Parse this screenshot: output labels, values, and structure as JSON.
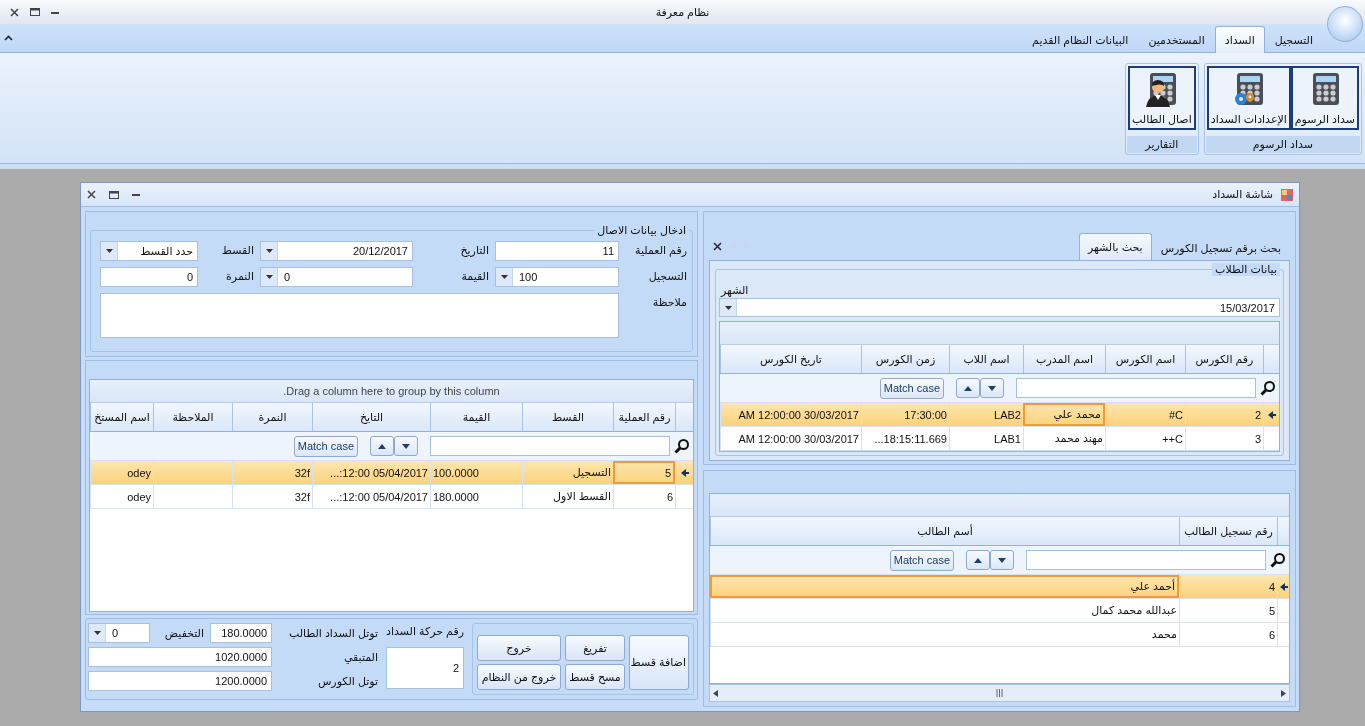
{
  "window": {
    "title": "نظام معرفة"
  },
  "ribbon": {
    "tabs": [
      {
        "label": "التسجيل",
        "selected": false
      },
      {
        "label": "السداد",
        "selected": true
      },
      {
        "label": "المستخدمين",
        "selected": false
      },
      {
        "label": "البيانات النظام القديم",
        "selected": false
      }
    ],
    "groups": [
      {
        "title": "سداد الرسوم",
        "buttons": [
          {
            "label": "سداد الرسوم",
            "kind": "calculator"
          },
          {
            "label": "الإعدادات السداد",
            "kind": "calculator-gear"
          }
        ]
      },
      {
        "title": "التقارير",
        "buttons": [
          {
            "label": "اصال الطالب",
            "kind": "person"
          }
        ]
      }
    ]
  },
  "child_window": {
    "title": "شاشة السداد",
    "entry": {
      "title": "ادخال بيانات الاصال",
      "fields": [
        {
          "label": "رقم العملية",
          "kind": "text",
          "value": "11"
        },
        {
          "label": "التاريخ",
          "kind": "dropdown",
          "value": "20/12/2017"
        },
        {
          "label": "القسط",
          "kind": "dropdown",
          "value": "حدد القسط"
        },
        {
          "label": "التسجيل",
          "kind": "combo",
          "value": "100"
        },
        {
          "label": "القيمة",
          "kind": "combo",
          "value": "0"
        },
        {
          "label": "النمرة",
          "kind": "text",
          "value": "0"
        },
        {
          "label": "ملاحظة",
          "kind": "memo"
        }
      ]
    },
    "payments_grid": {
      "group_panel": "Drag a column here to group by this column.",
      "columns": [
        "رقم العملية",
        "القسط",
        "القيمة",
        "التايخ",
        "النمرة",
        "الملاحظة",
        "اسم المستخ"
      ],
      "search": {
        "match_case": "Match case"
      },
      "rows": [
        {
          "selected": true,
          "cells": [
            {
              "text": "5",
              "focused": true
            },
            {
              "text": "التسجيل",
              "focused": false
            },
            {
              "text": "100.0000",
              "focused": false
            },
            {
              "text": "05/04/2017 12:00:...",
              "focused": false
            },
            {
              "text": "32f",
              "focused": false
            },
            {
              "focused": false
            },
            {
              "text": "odey",
              "focused": false
            }
          ]
        },
        {
          "selected": false,
          "cells": [
            {
              "text": "6",
              "focused": false
            },
            {
              "text": "القسط الاول",
              "focused": false
            },
            {
              "text": "180.0000",
              "focused": false
            },
            {
              "text": "05/04/2017 12:00:...",
              "focused": false
            },
            {
              "text": "32f",
              "focused": false
            },
            {
              "focused": false
            },
            {
              "text": "odey",
              "focused": false
            }
          ]
        }
      ]
    },
    "footer": {
      "buttons": [
        "اضافة قسط",
        "تفريغ",
        "خروج",
        "مسح قسط",
        "خروج من النظام"
      ],
      "movement": {
        "label": "رقم حركة السداد",
        "value": "2"
      },
      "student_total": {
        "label": "توتل السداد الطالب",
        "value": "180.0000"
      },
      "discount": {
        "label": "التخفيض",
        "value": "0"
      },
      "remaining": {
        "label": "المتبقي",
        "value": "1020.0000"
      },
      "course_total": {
        "label": "توتل الكورس",
        "value": "1200.0000"
      }
    },
    "search_tabs": [
      {
        "label": "بحث برقم تسجيل الكورس",
        "selected": false
      },
      {
        "label": "بحث بالشهر",
        "selected": true
      }
    ],
    "students_group": {
      "title": "بيانات الطلاب",
      "month_label": "الشهر",
      "month_value": "15/03/2017"
    },
    "courses_grid": {
      "columns": [
        "رقم الكورس",
        "اسم الكورس",
        "اسم المدرب",
        "اسم اللاب",
        "زمن الكورس",
        "تاريخ الكورس"
      ],
      "search": {
        "match_case": "Match case"
      },
      "rows": [
        {
          "selected": true,
          "cells": [
            {
              "text": "2",
              "focused": false
            },
            {
              "text": "C#",
              "focused": false
            },
            {
              "text": "محمد علي",
              "focused": true
            },
            {
              "text": "LAB2",
              "focused": false
            },
            {
              "text": "17:30:00",
              "focused": false
            },
            {
              "text": "30/03/2017 12:00:00 AM",
              "focused": false
            }
          ]
        },
        {
          "selected": false,
          "cells": [
            {
              "text": "3",
              "focused": false
            },
            {
              "text": "C++",
              "focused": false
            },
            {
              "text": "مهند محمد",
              "focused": false
            },
            {
              "text": "LAB1",
              "focused": false
            },
            {
              "text": "18:15:11.669...",
              "focused": false
            },
            {
              "text": "30/03/2017 12:00:00 AM",
              "focused": false
            }
          ]
        }
      ]
    },
    "students_grid": {
      "columns": [
        "رقم تسجيل الطالب",
        "أسم الطالب"
      ],
      "search": {
        "match_case": "Match case"
      },
      "rows": [
        {
          "selected": true,
          "cells": [
            {
              "text": "4",
              "focused": false
            },
            {
              "text": "أحمد علي",
              "focused": true
            }
          ]
        },
        {
          "selected": false,
          "cells": [
            {
              "text": "5",
              "focused": false
            },
            {
              "text": "عبدالله محمد كمال",
              "focused": false
            }
          ]
        },
        {
          "selected": false,
          "cells": [
            {
              "text": "6",
              "focused": false
            },
            {
              "text": "محمد",
              "focused": false
            }
          ]
        }
      ]
    }
  }
}
